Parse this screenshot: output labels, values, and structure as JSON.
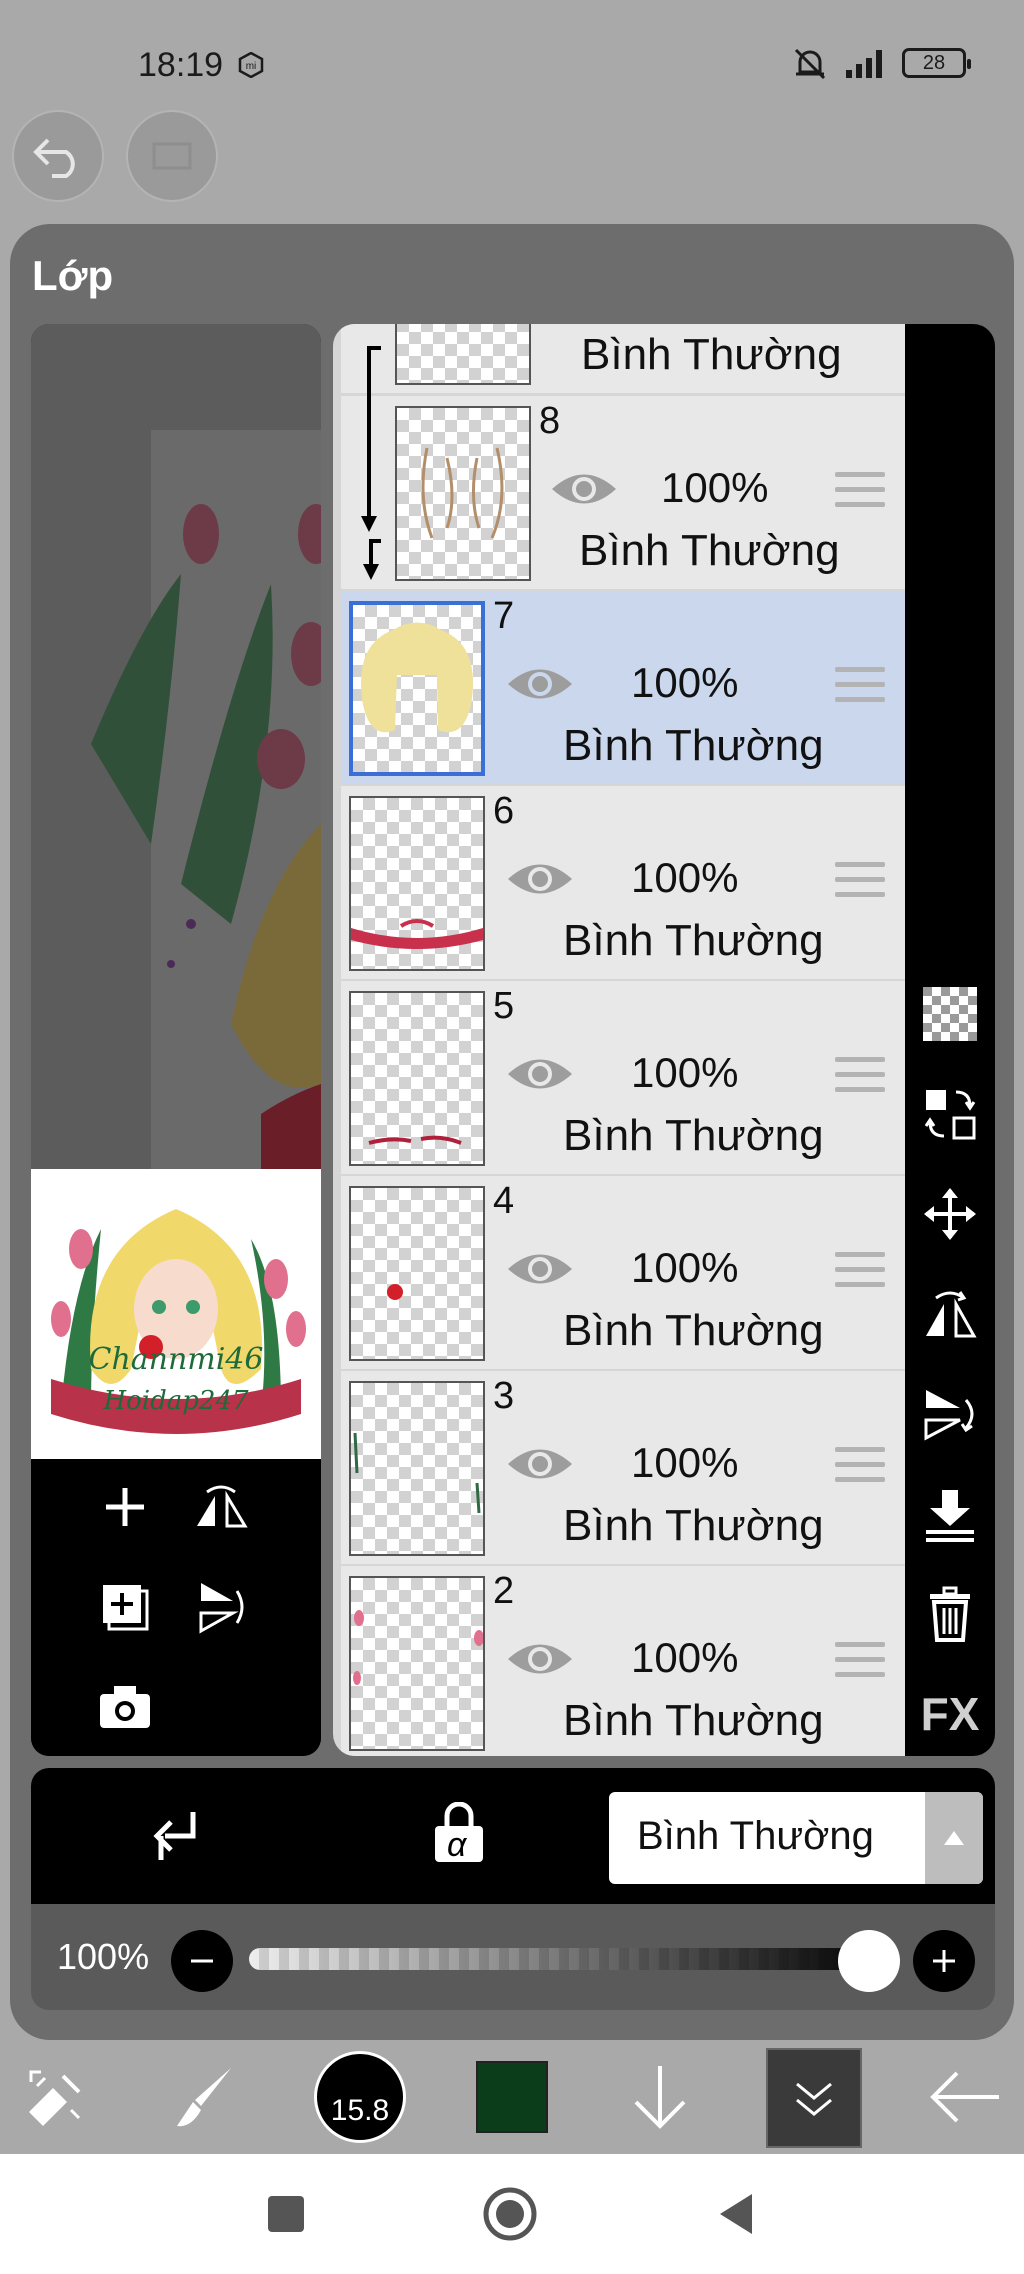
{
  "status_bar": {
    "time": "18:19",
    "battery": "28"
  },
  "panel": {
    "title": "Lớp"
  },
  "layers": [
    {
      "number": "",
      "opacity": "",
      "blend": "Bình Thường"
    },
    {
      "number": "8",
      "opacity": "100%",
      "blend": "Bình Thường"
    },
    {
      "number": "7",
      "opacity": "100%",
      "blend": "Bình Thường",
      "selected": true
    },
    {
      "number": "6",
      "opacity": "100%",
      "blend": "Bình Thường"
    },
    {
      "number": "5",
      "opacity": "100%",
      "blend": "Bình Thường"
    },
    {
      "number": "4",
      "opacity": "100%",
      "blend": "Bình Thường"
    },
    {
      "number": "3",
      "opacity": "100%",
      "blend": "Bình Thường"
    },
    {
      "number": "2",
      "opacity": "100%",
      "blend": "Bình Thường"
    }
  ],
  "right_tools": {
    "fx_label": "FX"
  },
  "blend_mode": {
    "selected": "Bình Thường",
    "alpha_symbol": "α"
  },
  "opacity": {
    "label": "100%",
    "value_percent": 100
  },
  "bottom_toolbar": {
    "brush_size": "15.8",
    "color": "#0b3d1a"
  },
  "preview_watermark": {
    "line1": "Channmi46",
    "line2": "Hoidap247"
  }
}
